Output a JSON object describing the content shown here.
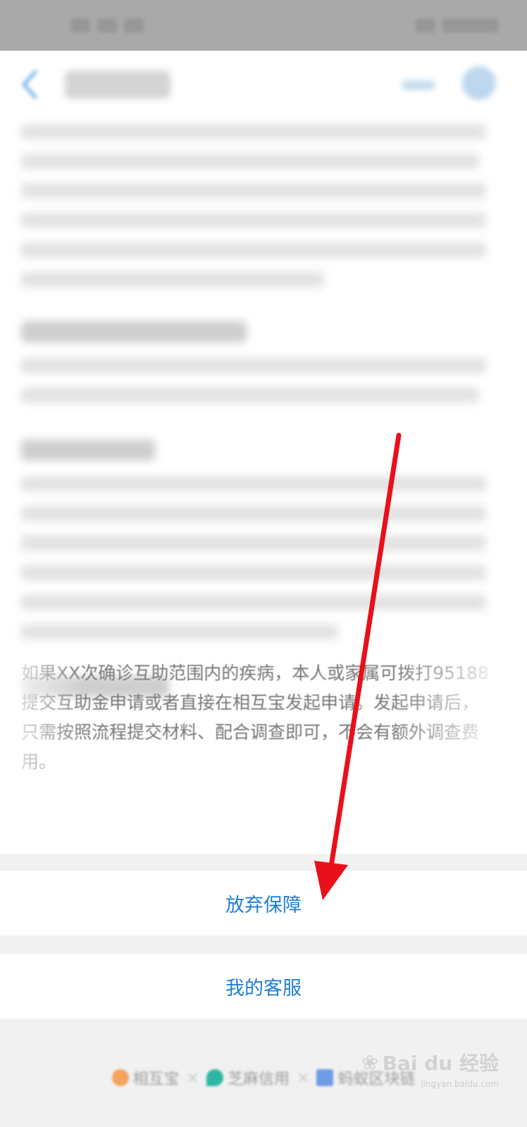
{
  "colors": {
    "accent": "#1f7ed6",
    "annotation_arrow": "#e8101a",
    "overlay_dim": "#a9a9a9"
  },
  "status_bar": {
    "left_icons": [
      "signal-icon",
      "wifi-icon",
      "notification-icon"
    ],
    "right_icons": [
      "battery-icon",
      "time-icon"
    ]
  },
  "page": {
    "visible_section": {
      "question": "",
      "body": "如果XX次确诊互助范围内的疾病，本人或家属可拨打95188提交互助金申请或者直接在相互宝发起申请。发起申请后，只需按照流程提交材料、配合调查即可，不会有额外调查费用。"
    }
  },
  "action_sheet": {
    "abandon_label": "放弃保障",
    "service_label": "我的客服"
  },
  "footer": {
    "brands": [
      {
        "name": "相互宝",
        "icon": "heart-icon",
        "color": "#f5a25d"
      },
      {
        "name": "芝麻信用",
        "icon": "drop-icon",
        "color": "#2db6a3"
      },
      {
        "name": "蚂蚁区块链",
        "icon": "blockchain-icon",
        "color": "#6f9be8"
      }
    ],
    "separator": "×"
  },
  "watermark": {
    "main": "Bai du 经验",
    "sub": "jingyan.baidu.com"
  }
}
